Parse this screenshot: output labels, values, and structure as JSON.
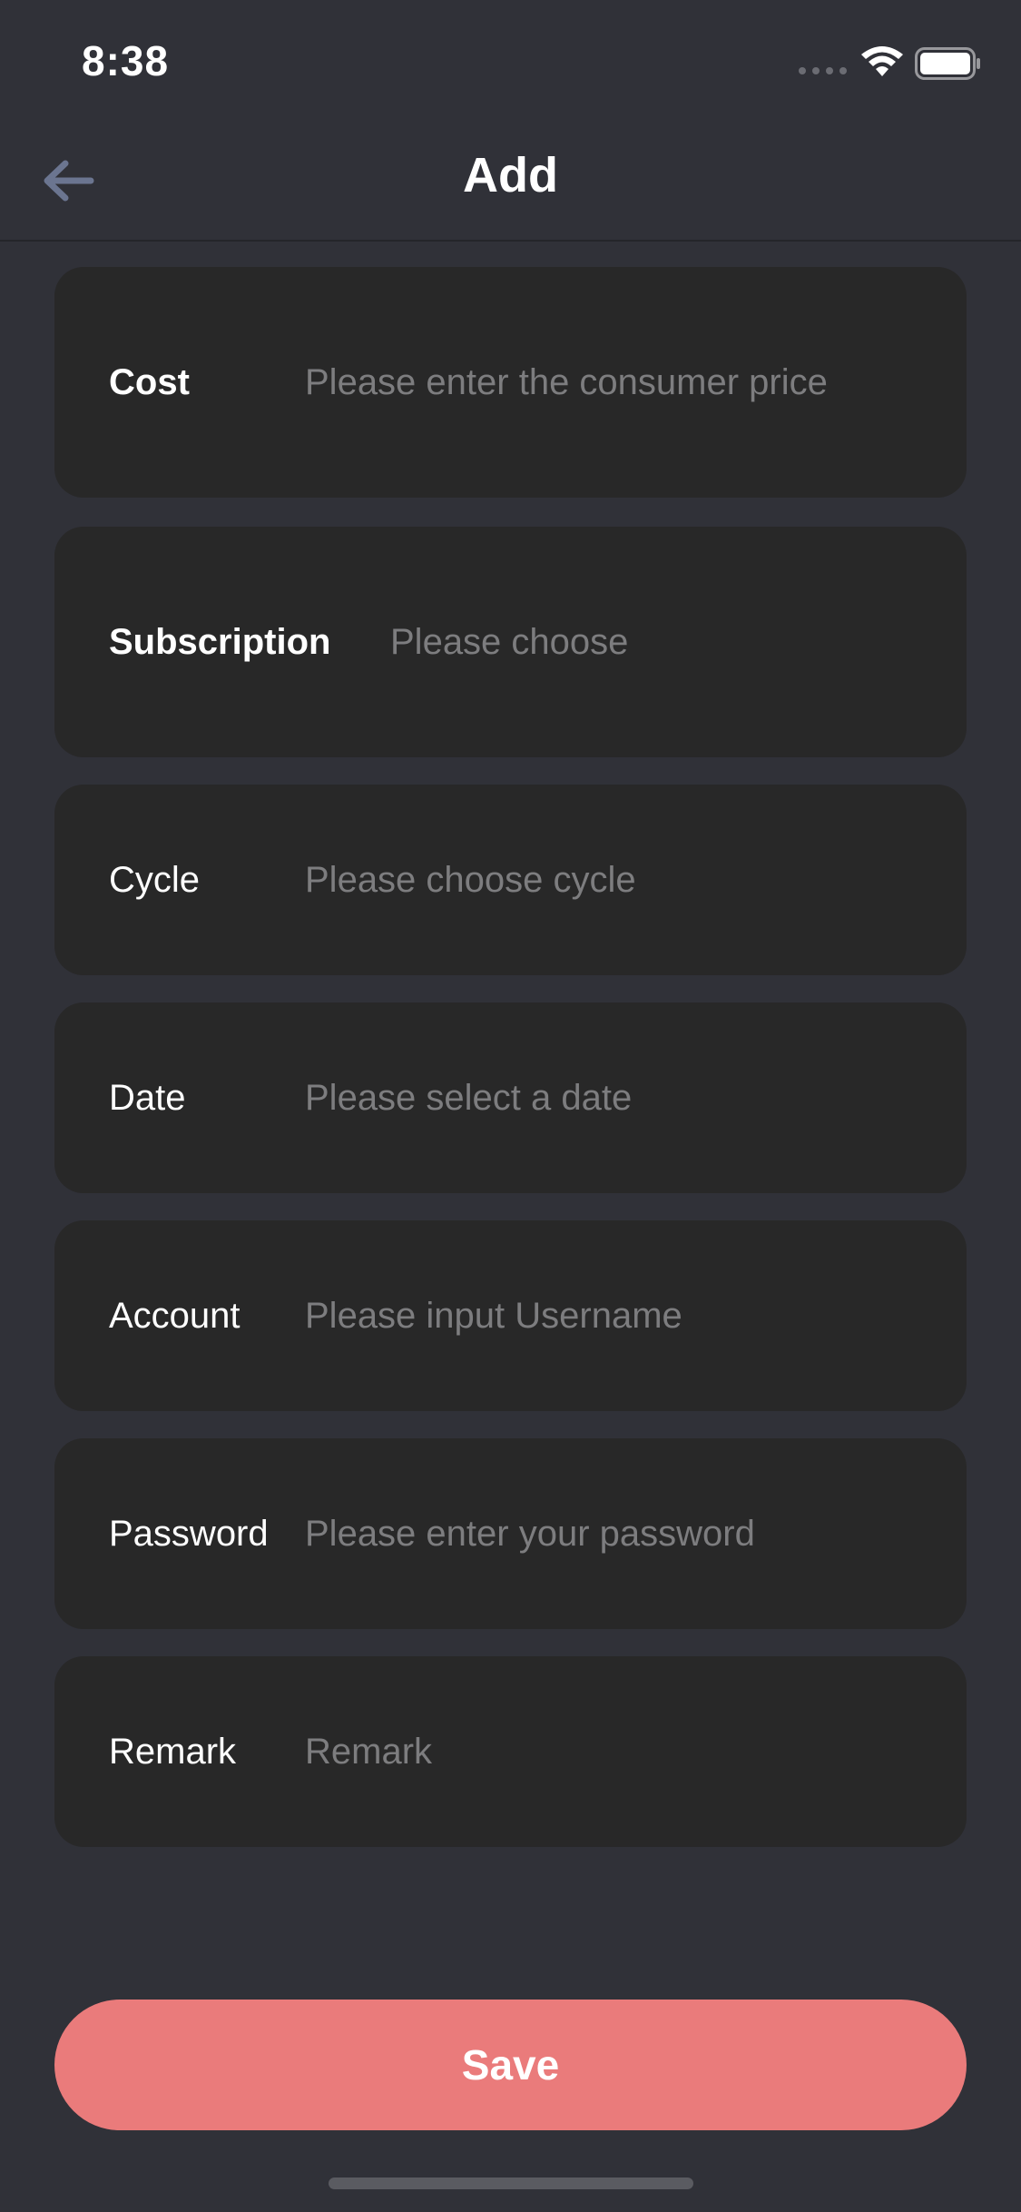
{
  "status_bar": {
    "time": "8:38"
  },
  "nav": {
    "title": "Add",
    "back_icon": "arrow-left-icon"
  },
  "form": {
    "cost": {
      "label": "Cost",
      "placeholder": "Please enter the consumer price",
      "value": ""
    },
    "subscription": {
      "label": "Subscription",
      "placeholder": "Please choose",
      "value": ""
    },
    "cycle": {
      "label": "Cycle",
      "placeholder": "Please choose cycle",
      "value": ""
    },
    "date": {
      "label": "Date",
      "placeholder": "Please select a date",
      "value": ""
    },
    "account": {
      "label": "Account",
      "placeholder": "Please input Username",
      "value": ""
    },
    "password": {
      "label": "Password",
      "placeholder": "Please enter your password",
      "value": ""
    },
    "remark": {
      "label": "Remark",
      "placeholder": "Remark",
      "value": ""
    }
  },
  "save_label": "Save",
  "colors": {
    "background": "#303138",
    "row_background": "#282828",
    "accent": "#ea7b7b",
    "placeholder": "#7d7d7f",
    "back_arrow": "#6b7590"
  }
}
